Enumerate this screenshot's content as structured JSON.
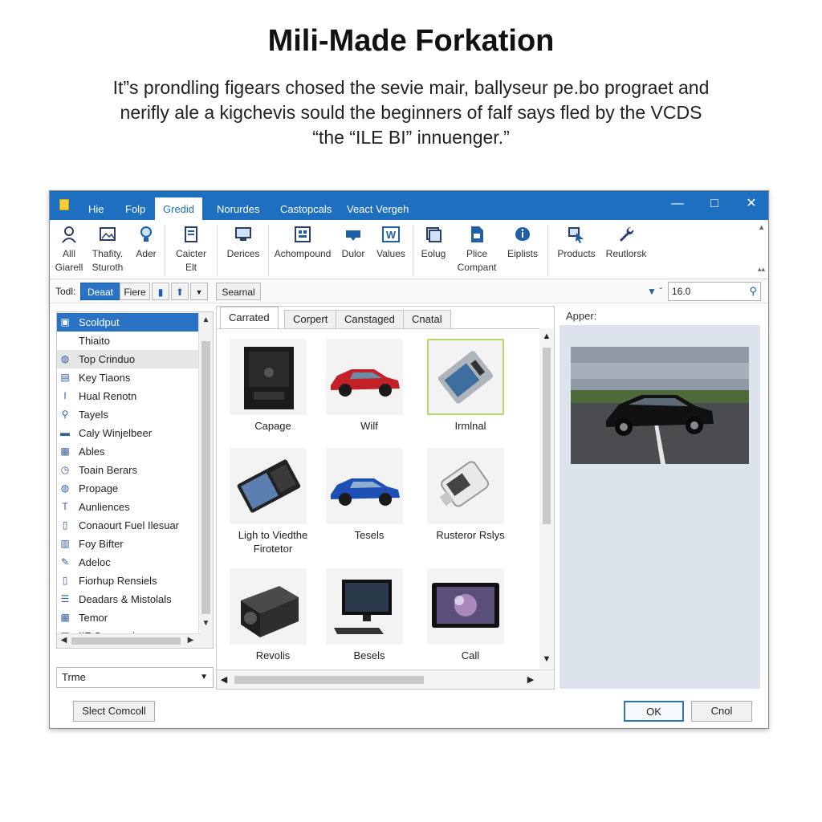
{
  "page": {
    "title": "Mili-Made Forkation",
    "intro_lines": [
      "It”s prondling figears chosed the sevie mair, ballyseur pe.bo prograet and",
      "nerifly ale a kigchevis sould the beginners of falf says fled by the VCDS",
      "“the “ILE BI” innuenger.”"
    ]
  },
  "window": {
    "menu_tabs": [
      "Hie",
      "Folp",
      "Gredid",
      "Norurdes",
      "Castopcals",
      "Veact Vergeh"
    ],
    "active_menu_tab": "Gredid",
    "window_controls": {
      "minimize": "—",
      "maximize": "□",
      "close": "✕"
    },
    "ribbon": [
      {
        "icon": "user-icon",
        "label": "Alll\nGiarell"
      },
      {
        "icon": "image-icon",
        "label": "Thafity.\nSturoth"
      },
      {
        "icon": "bulb-icon",
        "label": "Ader"
      },
      {
        "icon": "document-icon",
        "label": "Caicter\nElt"
      },
      {
        "icon": "monitor-icon",
        "label": "Derices"
      },
      {
        "icon": "grid-icon",
        "label": "Achompound"
      },
      {
        "icon": "tag-icon",
        "label": "Dulor"
      },
      {
        "icon": "w-icon",
        "label": "Values"
      },
      {
        "icon": "stack-icon",
        "label": "Eolug"
      },
      {
        "icon": "file-icon",
        "label": "Plice\nCompant"
      },
      {
        "icon": "info-icon",
        "label": "Eiplists"
      },
      {
        "icon": "cursor-icon",
        "label": "Products"
      },
      {
        "icon": "wrench-icon",
        "label": "Reutlorsk"
      }
    ],
    "toolbar": {
      "label": "Todl:",
      "btn_primary": "Deaat",
      "btn_secondary": "Fiere",
      "tab_label": "Searnal",
      "search_value": "16.0"
    },
    "sidebar": {
      "items": [
        {
          "icon": "monitor-icon",
          "label": "Scoldput",
          "selected": true
        },
        {
          "icon": "blank-icon",
          "label": "Thiaito"
        },
        {
          "icon": "globe-icon",
          "label": "Top Crinduo",
          "hover": true
        },
        {
          "icon": "keyboard-icon",
          "label": "Key Tiaons"
        },
        {
          "icon": "text-cursor-icon",
          "label": "Hual Renotn"
        },
        {
          "icon": "magnifier-icon",
          "label": "Tayels"
        },
        {
          "icon": "car-icon",
          "label": "Caly Winjelbeer"
        },
        {
          "icon": "grid-icon",
          "label": "Ables"
        },
        {
          "icon": "clock-icon",
          "label": "Toain Berars"
        },
        {
          "icon": "globe-icon",
          "label": "Propage"
        },
        {
          "icon": "text-icon",
          "label": "Aunliences"
        },
        {
          "icon": "page-icon",
          "label": "Conaourt Fuel Ilesuar"
        },
        {
          "icon": "chart-icon",
          "label": "Foy Bifter"
        },
        {
          "icon": "edit-icon",
          "label": "Adeloc"
        },
        {
          "icon": "page-icon",
          "label": "Fiorhup Rensiels"
        },
        {
          "icon": "list-icon",
          "label": "Deadars & Mistolals"
        },
        {
          "icon": "table-icon",
          "label": "Temor"
        },
        {
          "icon": "table-icon",
          "label": "IIF Compacic"
        }
      ],
      "select_value": "Trme"
    },
    "tabs": [
      "Carrated",
      "Corpert",
      "Canstaged",
      "Cnatal"
    ],
    "active_tab": "Carrated",
    "tiles": [
      {
        "label": "Capage",
        "thumb": "device-box"
      },
      {
        "label": "Wilf",
        "thumb": "red-car"
      },
      {
        "label": "Irmlnal",
        "thumb": "card-device",
        "selected": true
      },
      {
        "label": "Ligh to Viedthe\nFirotetor",
        "thumb": "handheld"
      },
      {
        "label": "Tesels",
        "thumb": "blue-car"
      },
      {
        "label": "Rusteror Rslys",
        "thumb": "adapter"
      },
      {
        "label": "Revolis",
        "thumb": "cube-box"
      },
      {
        "label": "Besels",
        "thumb": "desktop"
      },
      {
        "label": "Call",
        "thumb": "tablet"
      }
    ],
    "preview_label": "Apper:",
    "footer": {
      "left_button": "Slect Comcoll",
      "ok_button": "OK",
      "cancel_button": "Cnol"
    }
  },
  "colors": {
    "accent": "#1f6fc0",
    "selection": "#2a72c4",
    "preview_bg": "#dde3ec"
  }
}
